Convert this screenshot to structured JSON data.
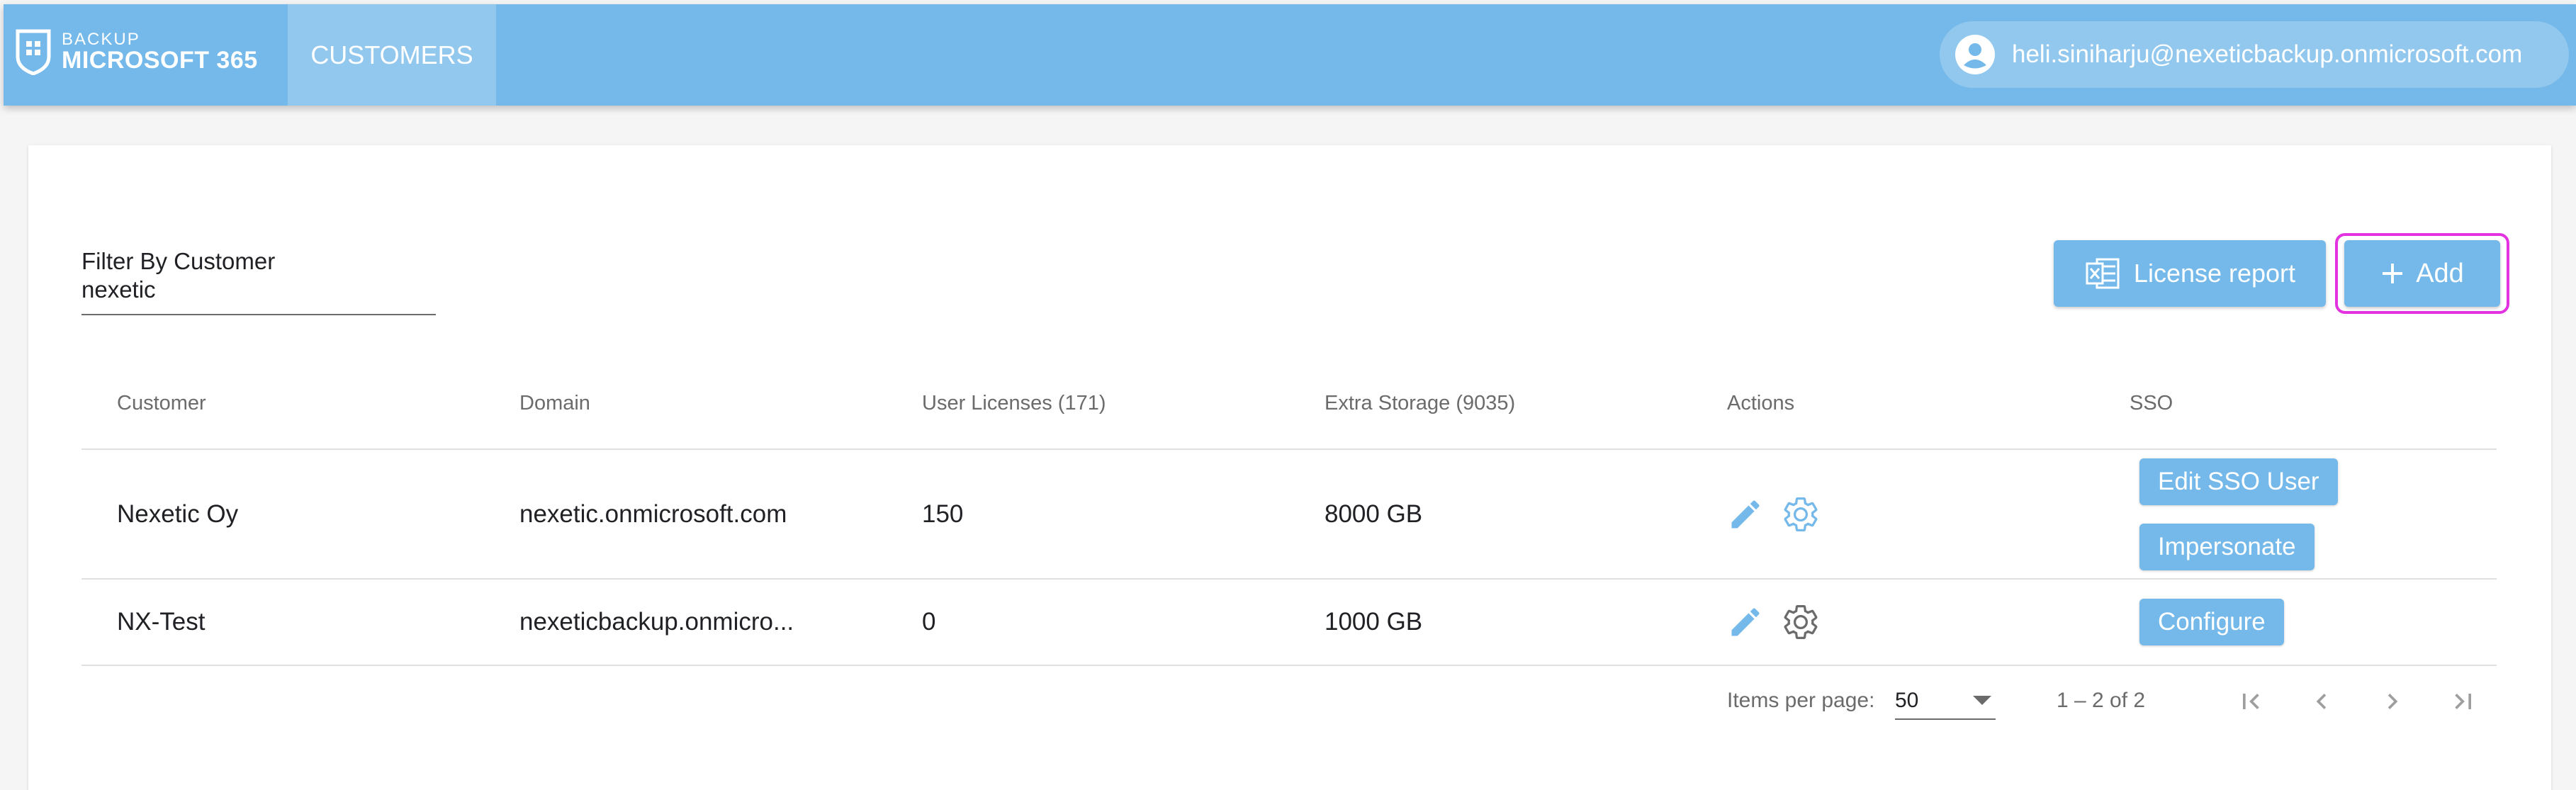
{
  "header": {
    "logo_small": "BACKUP",
    "logo_big": "MICROSOFT 365",
    "nav_tab": "CUSTOMERS",
    "user_email": "heli.siniharju@nexeticbackup.onmicrosoft.com"
  },
  "filter": {
    "label": "Filter By Customer",
    "value": "nexetic"
  },
  "buttons": {
    "license_report": "License report",
    "add": "Add"
  },
  "table": {
    "columns": [
      "Customer",
      "Domain",
      "User Licenses (171)",
      "Extra Storage (9035)",
      "Actions",
      "SSO"
    ],
    "rows": [
      {
        "customer": "Nexetic Oy",
        "domain": "nexetic.onmicrosoft.com",
        "user_licenses": "150",
        "extra_storage": "8000 GB",
        "sso_buttons": [
          "Edit SSO User",
          "Impersonate"
        ]
      },
      {
        "customer": "NX-Test",
        "domain": "nexeticbackup.onmicro...",
        "user_licenses": "0",
        "extra_storage": "1000 GB",
        "sso_buttons": [
          "Configure"
        ]
      }
    ]
  },
  "paginator": {
    "items_per_page_label": "Items per page:",
    "items_per_page_value": "50",
    "range_label": "1 – 2 of 2"
  },
  "colors": {
    "primary": "#74b9ea",
    "highlight": "#e332e0",
    "header_text": "#ffffff"
  },
  "icons": [
    "shield-logo-icon",
    "account-circle-icon",
    "excel-icon",
    "plus-icon",
    "pencil-icon",
    "gear-icon",
    "first-page-icon",
    "prev-page-icon",
    "next-page-icon",
    "last-page-icon"
  ]
}
